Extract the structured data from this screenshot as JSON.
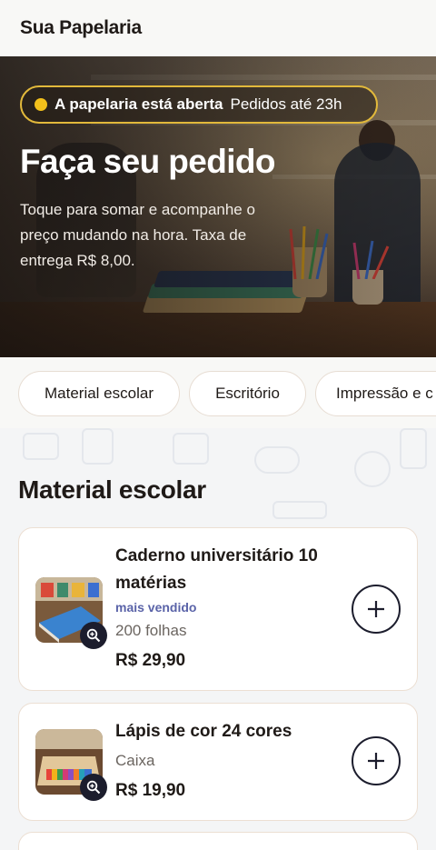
{
  "header": {
    "brand": "Sua Papelaria"
  },
  "hero": {
    "status_main": "A papelaria está aberta",
    "status_sub": "Pedidos até 23h",
    "title": "Faça seu pedido",
    "description": "Toque para somar e acompanhe o preço mudando na hora. Taxa de entrega R$ 8,00."
  },
  "categories": [
    "Material escolar",
    "Escritório",
    "Impressão e c"
  ],
  "section": {
    "title": "Material escolar"
  },
  "products": [
    {
      "name": "Caderno universitário 10 matérias",
      "tag": "mais vendido",
      "meta": "200 folhas",
      "price": "R$ 29,90"
    },
    {
      "name": "Lápis de cor 24 cores",
      "meta": "Caixa",
      "price": "R$ 19,90"
    }
  ],
  "colors": {
    "accent": "#e2b93b",
    "status_dot": "#f2c01b",
    "tag": "#5a63a8",
    "dark_button": "#1c1d2d"
  },
  "icons": [
    "zoom-in-icon",
    "plus-icon",
    "status-dot-icon"
  ]
}
